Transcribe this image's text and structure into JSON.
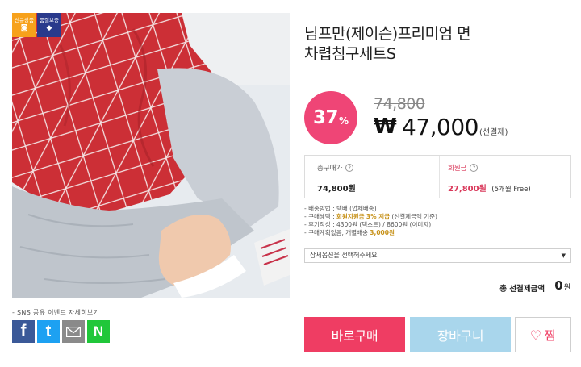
{
  "badges": {
    "new_label": "신규상품",
    "quality_label": "품질보증"
  },
  "product": {
    "title_line1": "님프만(제이슨)프리미엄 면",
    "title_line2": "차렵침구세트S"
  },
  "pricing": {
    "discount_number": "37",
    "discount_unit": "%",
    "original_price": "74,800",
    "currency_symbol": "₩",
    "sale_price": "47,000",
    "payment_note": "(선결제)"
  },
  "info_box": {
    "total_purchase_label": "총구매가",
    "total_purchase_value": "74,800원",
    "membership_label": "회원금",
    "membership_value": "27,800원",
    "membership_sub": "(5개월 Free)"
  },
  "details": {
    "line1": "- 배송방법 : 택배 (업체배송)",
    "line2_prefix": "- 구매혜택 : ",
    "line2_highlight1": "회원지원금",
    "line2_highlight2": "3% 지급",
    "line2_suffix": " (선결제금액 기준)",
    "line3": "- 후기작성 : 4300원 (텍스트) / 8600원 (이미지)",
    "line4_prefix": "- 구매계획없음, 개별배송 ",
    "line4_highlight": "3,000원"
  },
  "option": {
    "placeholder": "상세옵션을 선택해주세요",
    "arrow": "▼"
  },
  "total": {
    "label": "총 선결제금액",
    "value": "0",
    "unit": "원"
  },
  "buttons": {
    "buy": "바로구매",
    "cart": "장바구니",
    "wish": "찜",
    "wish_icon": "♡"
  },
  "sns": {
    "label": "- SNS 공유 이벤트 자세히보기",
    "facebook_glyph": "f",
    "twitter_glyph": "t",
    "naver_glyph": "N"
  },
  "colors": {
    "accent_pink": "#ef4576",
    "buy_button": "#ef3d63",
    "cart_button": "#a9d6ec",
    "badge_new": "#f7a11b",
    "badge_quality": "#2a3a8c"
  }
}
